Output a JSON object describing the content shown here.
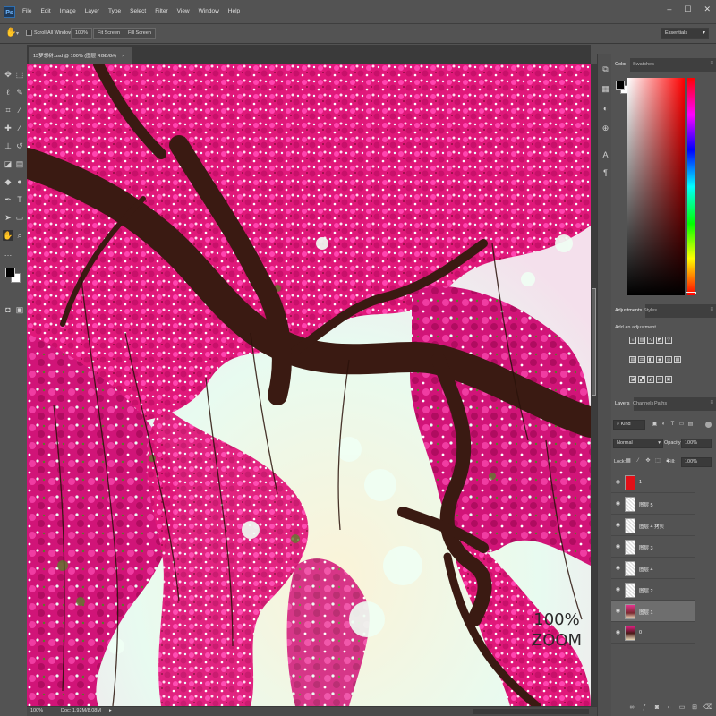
{
  "app": {
    "logo": "Ps",
    "menu": [
      "File",
      "Edit",
      "Image",
      "Layer",
      "Type",
      "Select",
      "Filter",
      "View",
      "Window",
      "Help"
    ],
    "window_controls": [
      "–",
      "☐",
      "✕"
    ]
  },
  "options_bar": {
    "scroll_all_windows": "Scroll All Windows",
    "zoom_btn": "100%",
    "fit_screen": "Fit Screen",
    "fill_screen": "Fill Screen",
    "workspace": "Essentials"
  },
  "document": {
    "tab_title": "13梦想树.psd @ 100% (图层 RGB/8#)",
    "tab_close": "×",
    "status_zoom": "100%",
    "status_doc": "Doc: 1.92M/8.08M",
    "status_arrow": "▸",
    "watermark_line1": "100%",
    "watermark_line2": "ZOOM"
  },
  "colors": {
    "foreground": "#000000",
    "background": "#ffffff",
    "blossom": "#e0187a",
    "branch": "#3a1a12",
    "sky": "#e8fbf0"
  },
  "panels": {
    "color_tabs": [
      "Color",
      "Swatches"
    ],
    "adjust_tabs": [
      "Adjustments",
      "Styles"
    ],
    "add_adjustment": "Add an adjustment",
    "layers_tabs": [
      "Layers",
      "Channels",
      "Paths"
    ],
    "menu_glyph": "≡"
  },
  "layers_panel": {
    "kind": "Kind",
    "blend_mode": "Normal",
    "opacity_label": "Opacity:",
    "opacity": "100%",
    "lock_label": "Lock:",
    "fill_label": "Fill:",
    "fill": "100%",
    "layers": [
      {
        "name": "1",
        "thumb": "red"
      },
      {
        "name": "图层 5",
        "thumb": "blank"
      },
      {
        "name": "图层 4 拷贝",
        "thumb": "blank"
      },
      {
        "name": "图层 3",
        "thumb": "blank"
      },
      {
        "name": "图层 4",
        "thumb": "blank"
      },
      {
        "name": "图层 2",
        "thumb": "blank"
      },
      {
        "name": "图层 1",
        "thumb": "photo",
        "selected": true
      },
      {
        "name": "0",
        "thumb": "photo2"
      }
    ]
  }
}
